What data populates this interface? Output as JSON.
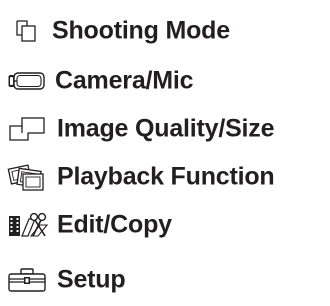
{
  "menu": {
    "items": [
      {
        "label": "Shooting Mode",
        "icon": "shooting-mode-icon"
      },
      {
        "label": "Camera/Mic",
        "icon": "camcorder-icon"
      },
      {
        "label": "Image Quality/Size",
        "icon": "image-quality-icon"
      },
      {
        "label": "Playback Function",
        "icon": "photos-stack-icon"
      },
      {
        "label": "Edit/Copy",
        "icon": "film-scissors-icon"
      },
      {
        "label": "Setup",
        "icon": "toolbox-icon"
      }
    ]
  },
  "colors": {
    "text": "#231f20",
    "background": "#ffffff"
  }
}
